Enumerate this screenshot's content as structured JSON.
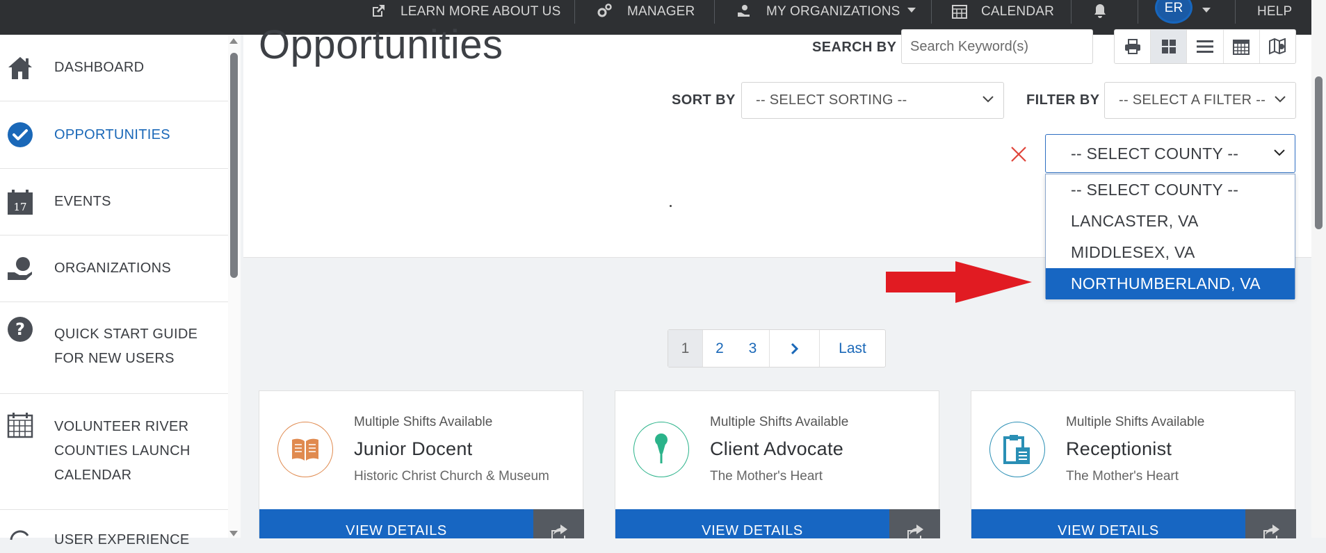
{
  "topnav": {
    "learn_more": "LEARN MORE ABOUT US",
    "manager": "MANAGER",
    "my_orgs": "MY ORGANIZATIONS",
    "calendar": "CALENDAR",
    "avatar_initials": "ER",
    "help": "HELP"
  },
  "sidebar": {
    "items": [
      {
        "label": "DASHBOARD",
        "icon": "home-icon"
      },
      {
        "label": "OPPORTUNITIES",
        "icon": "check-circle-icon",
        "active": true
      },
      {
        "label": "EVENTS",
        "icon": "calendar-17-icon"
      },
      {
        "label": "ORGANIZATIONS",
        "icon": "hand-globe-icon"
      },
      {
        "label": "QUICK START GUIDE FOR NEW USERS",
        "icon": "question-circle-icon"
      },
      {
        "label": "VOLUNTEER RIVER COUNTIES LAUNCH CALENDAR",
        "icon": "calendar-grid-icon"
      },
      {
        "label": "USER EXPERIENCE",
        "icon": "refresh-icon"
      }
    ]
  },
  "header": {
    "title": "Opportunities",
    "search_by_label": "SEARCH BY",
    "search_placeholder": "Search Keyword(s)",
    "sort_by_label": "SORT BY",
    "sort_value": "-- SELECT SORTING --",
    "filter_by_label": "FILTER BY",
    "filter_value": "-- SELECT A FILTER --",
    "county_value": "-- SELECT COUNTY --",
    "view_icons": [
      "print-icon",
      "grid-view-icon",
      "list-view-icon",
      "calendar-view-icon",
      "map-view-icon"
    ]
  },
  "county_dropdown": {
    "options": [
      "-- SELECT COUNTY --",
      "LANCASTER, VA",
      "MIDDLESEX, VA",
      "NORTHUMBERLAND, VA"
    ],
    "highlighted": "NORTHUMBERLAND, VA"
  },
  "pagination": {
    "pages": [
      "1",
      "2",
      "3"
    ],
    "current": "1",
    "last_label": "Last"
  },
  "cards": [
    {
      "shifts": "Multiple Shifts Available",
      "title": "Junior Docent",
      "org": "Historic Christ Church & Museum",
      "icon": "book-icon",
      "color": "#e08a4f",
      "button": "VIEW DETAILS"
    },
    {
      "shifts": "Multiple Shifts Available",
      "title": "Client Advocate",
      "org": "The Mother's Heart",
      "icon": "microphone-icon",
      "color": "#2bb38a",
      "button": "VIEW DETAILS"
    },
    {
      "shifts": "Multiple Shifts Available",
      "title": "Receptionist",
      "org": "The Mother's Heart",
      "icon": "clipboard-icon",
      "color": "#2a8fb5",
      "button": "VIEW DETAILS"
    }
  ],
  "colors": {
    "nav_bg": "#2e3033",
    "primary": "#1766c2",
    "accent_red": "#e11b22"
  }
}
